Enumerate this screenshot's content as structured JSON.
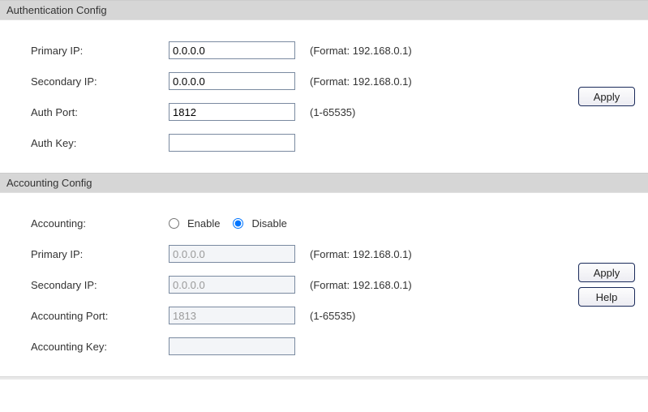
{
  "auth": {
    "header": "Authentication Config",
    "primary_ip_label": "Primary IP:",
    "primary_ip_value": "0.0.0.0",
    "primary_ip_hint": "(Format: 192.168.0.1)",
    "secondary_ip_label": "Secondary IP:",
    "secondary_ip_value": "0.0.0.0",
    "secondary_ip_hint": "(Format: 192.168.0.1)",
    "port_label": "Auth Port:",
    "port_value": "1812",
    "port_hint": "(1-65535)",
    "key_label": "Auth Key:",
    "key_value": "",
    "apply_label": "Apply"
  },
  "acct": {
    "header": "Accounting Config",
    "accounting_label": "Accounting:",
    "enable_label": "Enable",
    "disable_label": "Disable",
    "selected": "disable",
    "primary_ip_label": "Primary IP:",
    "primary_ip_value": "0.0.0.0",
    "primary_ip_hint": "(Format: 192.168.0.1)",
    "secondary_ip_label": "Secondary IP:",
    "secondary_ip_value": "0.0.0.0",
    "secondary_ip_hint": "(Format: 192.168.0.1)",
    "port_label": "Accounting Port:",
    "port_value": "1813",
    "port_hint": "(1-65535)",
    "key_label": "Accounting Key:",
    "key_value": "",
    "apply_label": "Apply",
    "help_label": "Help"
  }
}
